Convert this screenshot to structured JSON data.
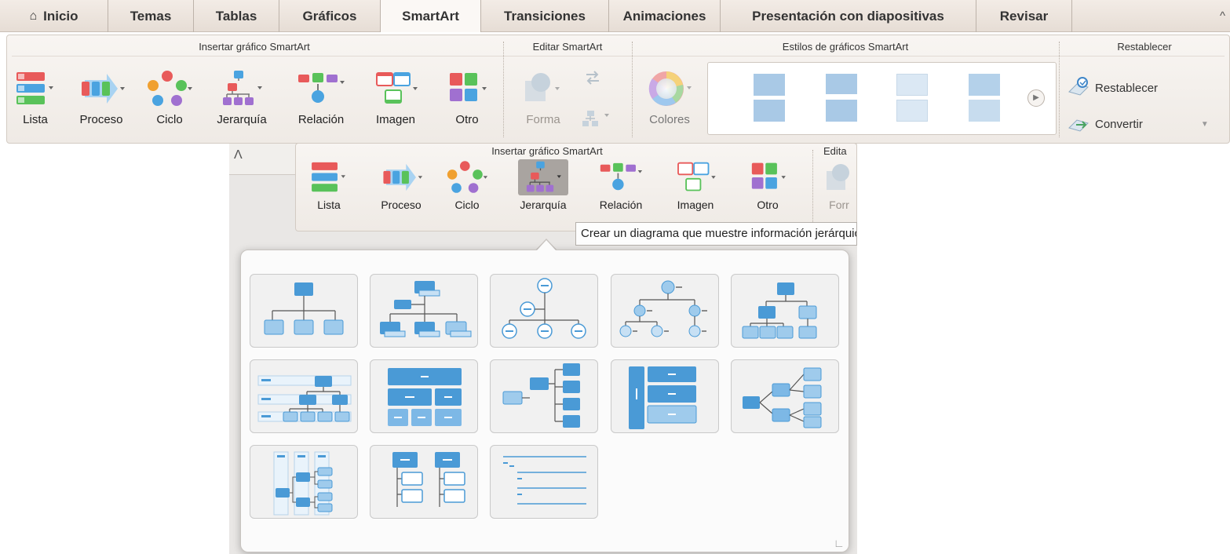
{
  "tabs": [
    {
      "label": "Inicio",
      "active": false
    },
    {
      "label": "Temas",
      "active": false
    },
    {
      "label": "Tablas",
      "active": false
    },
    {
      "label": "Gráficos",
      "active": false
    },
    {
      "label": "SmartArt",
      "active": true
    },
    {
      "label": "Transiciones",
      "active": false
    },
    {
      "label": "Animaciones",
      "active": false
    },
    {
      "label": "Presentación con diapositivas",
      "active": false
    },
    {
      "label": "Revisar",
      "active": false
    }
  ],
  "ribbon": {
    "groups": {
      "insert": "Insertar gráfico SmartArt",
      "edit": "Editar SmartArt",
      "styles": "Estilos de gráficos SmartArt",
      "reset": "Restablecer"
    },
    "insert_buttons": [
      "Lista",
      "Proceso",
      "Ciclo",
      "Jerarquía",
      "Relación",
      "Imagen",
      "Otro"
    ],
    "edit_buttons": {
      "shape": "Forma"
    },
    "colors_label": "Colores",
    "reset_label": "Restablecer",
    "convert_label": "Convertir"
  },
  "ribbon2": {
    "group_title": "Insertar gráfico SmartArt",
    "edit_partial": "Edita",
    "buttons": [
      "Lista",
      "Proceso",
      "Ciclo",
      "Jerarquía",
      "Relación",
      "Imagen",
      "Otro"
    ],
    "shape_partial": "Forr"
  },
  "tooltip": "Crear un diagrama que muestre información jerárquica",
  "gallery": {
    "count": 13
  },
  "colors": {
    "accent_blue": "#4a9ad6",
    "tab_bar": "#e9e1d9",
    "ribbon": "#f3efeb"
  }
}
